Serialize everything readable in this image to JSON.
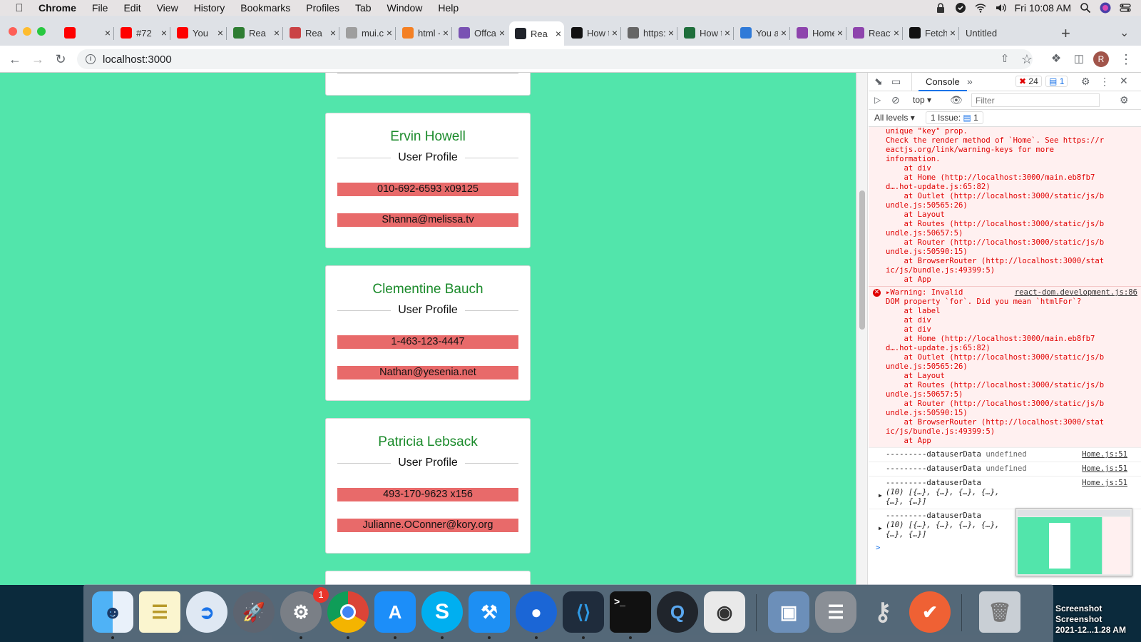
{
  "menubar": {
    "app": "Chrome",
    "items": [
      "File",
      "Edit",
      "View",
      "History",
      "Bookmarks",
      "Profiles",
      "Tab",
      "Window",
      "Help"
    ],
    "clock": "Fri 10:08 AM"
  },
  "tabs": [
    {
      "title": "",
      "icon": "youtube-icon",
      "color": "#ff0000"
    },
    {
      "title": "#72",
      "icon": "youtube-icon",
      "color": "#ff0000"
    },
    {
      "title": "You",
      "icon": "youtube-icon",
      "color": "#ff0000"
    },
    {
      "title": "Rea",
      "icon": "w3-icon",
      "color": "#2e7d32"
    },
    {
      "title": "Rea",
      "icon": "react-router-icon",
      "color": "#ca4245"
    },
    {
      "title": "mui.cor",
      "icon": "mui-icon",
      "color": "#9e9e9e"
    },
    {
      "title": "html - F",
      "icon": "stackoverflow-icon",
      "color": "#f48024"
    },
    {
      "title": "Offcanv",
      "icon": "bootstrap-icon",
      "color": "#7952b3"
    },
    {
      "title": "Rea",
      "icon": "react-icon",
      "color": "#20232a",
      "active": true
    },
    {
      "title": "How to",
      "icon": "medium-icon",
      "color": "#111111"
    },
    {
      "title": "https://",
      "icon": "generic-page-icon",
      "color": "#666666"
    },
    {
      "title": "How to",
      "icon": "codecademy-icon",
      "color": "#1f6f3c"
    },
    {
      "title": "You are",
      "icon": "s-icon",
      "color": "#2f7ad8"
    },
    {
      "title": "Homep",
      "icon": "circle-icon",
      "color": "#8e44ad"
    },
    {
      "title": "React F",
      "icon": "circle-icon",
      "color": "#8e44ad"
    },
    {
      "title": "Fetch A",
      "icon": "medium-icon",
      "color": "#111111"
    },
    {
      "title": "Untitled",
      "icon": "",
      "color": ""
    }
  ],
  "toolbar": {
    "url": "localhost:3000",
    "profile_initial": "R"
  },
  "page": {
    "cards": [
      {
        "name": "Ervin Howell",
        "subtitle": "User Profile",
        "phone": "010-692-6593 x09125",
        "email": "Shanna@melissa.tv"
      },
      {
        "name": "Clementine Bauch",
        "subtitle": "User Profile",
        "phone": "1-463-123-4447",
        "email": "Nathan@yesenia.net"
      },
      {
        "name": "Patricia Lebsack",
        "subtitle": "User Profile",
        "phone": "493-170-9623 x156",
        "email": "Julianne.OConner@kory.org"
      }
    ]
  },
  "devtools": {
    "tab_console": "Console",
    "errors_count": "24",
    "messages_count": "1",
    "context": "top",
    "filter_placeholder": "Filter",
    "levels": "All levels",
    "issues": "1 Issue:",
    "issues_count": "1",
    "error_block_1": [
      "unique \"key\" prop.",
      "",
      "Check the render method of `Home`. See https://r",
      "eactjs.org/link/warning-keys for more",
      "information.",
      "    at div",
      "    at Home (http://localhost:3000/main.eb8fb7",
      "d….hot-update.js:65:82)",
      "    at Outlet (http://localhost:3000/static/js/b",
      "undle.js:50565:26)",
      "    at Layout",
      "    at Routes (http://localhost:3000/static/js/b",
      "undle.js:50657:5)",
      "    at Router (http://localhost:3000/static/js/b",
      "undle.js:50590:15)",
      "    at BrowserRouter (http://localhost:3000/stat",
      "ic/js/bundle.js:49399:5)",
      "    at App"
    ],
    "error_block_2_source": "react-dom.development.js:86",
    "error_block_2": [
      "▸Warning: Invalid",
      "DOM property `for`. Did you mean `htmlFor`?",
      "    at label",
      "    at div",
      "    at div",
      "    at Home (http://localhost:3000/main.eb8fb7",
      "d….hot-update.js:65:82)",
      "    at Outlet (http://localhost:3000/static/js/b",
      "undle.js:50565:26)",
      "    at Layout",
      "    at Routes (http://localhost:3000/static/js/b",
      "undle.js:50657:5)",
      "    at Router (http://localhost:3000/static/js/b",
      "undle.js:50590:15)",
      "    at BrowserRouter (http://localhost:3000/stat",
      "ic/js/bundle.js:49399:5)",
      "    at App"
    ],
    "logs": [
      {
        "text": "---------datauserData ",
        "extra": "undefined",
        "source": "Home.js:51"
      },
      {
        "text": "---------datauserData ",
        "extra": "undefined",
        "source": "Home.js:51"
      },
      {
        "text": "---------datauserData",
        "extra": "",
        "source": "Home.js:51",
        "obj1": "(10) [{…}, {…}, {…}, {…},",
        "obj2": "{…}, {…}]"
      },
      {
        "text": "---------datauserData",
        "extra": "",
        "source": "",
        "obj1": "(10) [{…}, {…}, {…}, {…},",
        "obj2": "{…}, {…}]"
      }
    ],
    "prompt": ">"
  },
  "dock": {
    "apps": [
      "finder-icon",
      "notes-icon",
      "safari-icon",
      "launchpad-icon",
      "system-preferences-icon",
      "chrome-icon",
      "app-store-icon",
      "skype-icon",
      "xcode-icon",
      "sourcetree-icon",
      "vscode-icon",
      "terminal-icon",
      "quicktime-icon",
      "screenshot-icon",
      "preview-icon",
      "database-icon",
      "keychain-icon",
      "postman-icon",
      "trash-icon"
    ],
    "system_prefs_badge": "1",
    "desktop_label": [
      "Screenshot",
      "Screenshot",
      "2021-12...1.28 AM"
    ]
  },
  "colors": {
    "page_background": "#52e5ab",
    "name_text": "#1a8a2a",
    "field_background": "#e86a6a",
    "error_text": "#e00000",
    "error_background": "#fff0f0"
  }
}
